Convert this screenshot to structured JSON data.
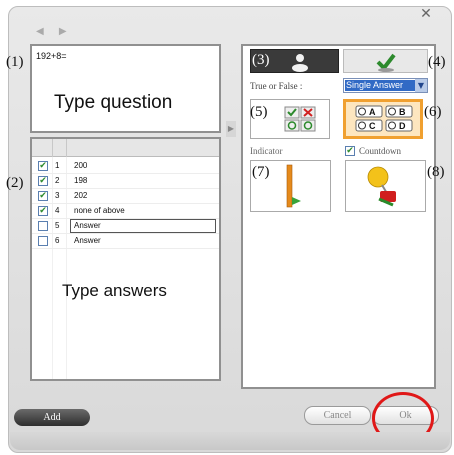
{
  "window": {
    "close_glyph": "✕",
    "nav_glyph": "◀ ▶",
    "side_arrow_glyph": "▶"
  },
  "question": {
    "text": "192+8=",
    "hint": "Type question"
  },
  "answers": {
    "rows": [
      {
        "checked": true,
        "num": "1",
        "text": "200"
      },
      {
        "checked": true,
        "num": "2",
        "text": "198"
      },
      {
        "checked": true,
        "num": "3",
        "text": "202"
      },
      {
        "checked": true,
        "num": "4",
        "text": "none of above"
      },
      {
        "checked": false,
        "num": "5",
        "text": "Answer"
      },
      {
        "checked": false,
        "num": "6",
        "text": "Answer"
      }
    ],
    "check_glyph": "✔",
    "hint": "Type answers",
    "remove_glyph": "−",
    "add_glyph": "+"
  },
  "settings": {
    "true_false_label": "True or False :",
    "answer_type": "Single Answer",
    "indicator_label": "Indicator",
    "countdown_label": "Countdown",
    "countdown_checked": true,
    "option_letters": [
      "A",
      "B",
      "C",
      "D"
    ]
  },
  "callouts": [
    "(1)",
    "(2)",
    "(3)",
    "(4)",
    "(5)",
    "(6)",
    "(7)",
    "(8)"
  ],
  "footer": {
    "add_label": "Add",
    "cancel_label": "Cancel",
    "ok_label": "Ok"
  },
  "colors": {
    "highlight_ring": "#e01818",
    "selected_card": "#f0a030",
    "check_green": "#2d8a2d"
  }
}
